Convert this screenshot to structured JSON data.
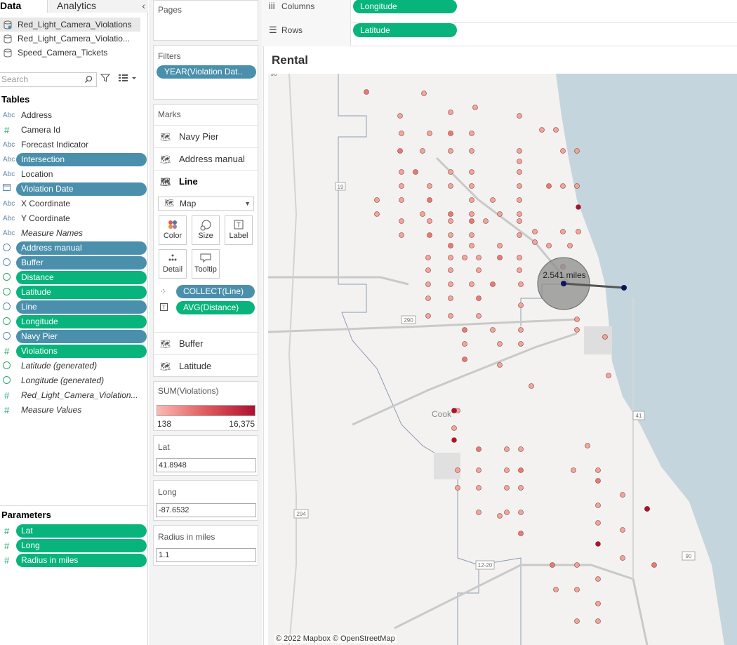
{
  "data_pane": {
    "tabs": {
      "data": "Data",
      "analytics": "Analytics"
    },
    "datasources": [
      "Red_Light_Camera_Violations",
      "Red_Light_Camera_Violatio...",
      "Speed_Camera_Tickets"
    ],
    "search_placeholder": "Search",
    "tables_title": "Tables",
    "fields": [
      {
        "type": "Abc",
        "name": "Address",
        "style": "plain"
      },
      {
        "type": "#",
        "name": "Camera Id",
        "style": "plain"
      },
      {
        "type": "Abc",
        "name": "Forecast Indicator",
        "style": "plain"
      },
      {
        "type": "Abc",
        "name": "Intersection",
        "style": "blue"
      },
      {
        "type": "Abc",
        "name": "Location",
        "style": "plain"
      },
      {
        "type": "date",
        "name": "Violation Date",
        "style": "blue"
      },
      {
        "type": "Abc",
        "name": "X Coordinate",
        "style": "plain"
      },
      {
        "type": "Abc",
        "name": "Y Coordinate",
        "style": "plain"
      },
      {
        "type": "Abc",
        "name": "Measure Names",
        "style": "italic"
      },
      {
        "type": "geo",
        "name": "Address manual",
        "style": "blue"
      },
      {
        "type": "geo",
        "name": "Buffer",
        "style": "blue"
      },
      {
        "type": "geo",
        "name": "Distance",
        "style": "green"
      },
      {
        "type": "geo",
        "name": "Latitude",
        "style": "green"
      },
      {
        "type": "geo",
        "name": "Line",
        "style": "blue"
      },
      {
        "type": "geo",
        "name": "Longitude",
        "style": "green"
      },
      {
        "type": "geo",
        "name": "Navy Pier",
        "style": "blue"
      },
      {
        "type": "#",
        "name": "Violations",
        "style": "green"
      },
      {
        "type": "geo",
        "name": "Latitude (generated)",
        "style": "italic"
      },
      {
        "type": "geo",
        "name": "Longitude (generated)",
        "style": "italic"
      },
      {
        "type": "#",
        "name": "Red_Light_Camera_Violation...",
        "style": "italic"
      },
      {
        "type": "#",
        "name": "Measure Values",
        "style": "italic"
      }
    ],
    "parameters_title": "Parameters",
    "parameters": [
      "Lat",
      "Long",
      "Radius in miles"
    ]
  },
  "shelves": {
    "pages_title": "Pages",
    "filters_title": "Filters",
    "filter_pill": "YEAR(Violation Dat..",
    "marks_title": "Marks",
    "marks_layers": [
      "Navy Pier",
      "Address manual",
      "Line"
    ],
    "mark_type": "Map",
    "mark_buttons": [
      "Color",
      "Size",
      "Label",
      "Detail",
      "Tooltip"
    ],
    "encodings": [
      {
        "icon": "detail",
        "label": "COLLECT(Line)",
        "color": "blue"
      },
      {
        "icon": "label",
        "label": "AVG(Distance)",
        "color": "green"
      }
    ],
    "marks_layers_bottom": [
      "Buffer",
      "Latitude"
    ],
    "legend": {
      "title": "SUM(Violations)",
      "min": "138",
      "max": "16,375"
    },
    "param_cards": [
      {
        "title": "Lat",
        "value": "41.8948"
      },
      {
        "title": "Long",
        "value": "-87.6532"
      },
      {
        "title": "Radius in miles",
        "value": "1.1"
      }
    ]
  },
  "columns_shelf": {
    "label": "Columns",
    "pill": "Longitude"
  },
  "rows_shelf": {
    "label": "Rows",
    "pill": "Latitude"
  },
  "viz": {
    "title": "Rental",
    "distance_label": "2.541 miles",
    "attribution": "© 2022 Mapbox © OpenStreetMap",
    "map_labels": {
      "cook": "Cook"
    },
    "highway_shields": [
      "90",
      "19",
      "290",
      "41",
      "294",
      "12-20",
      "41",
      "90"
    ],
    "colors": {
      "marker_light": "#f4a59b",
      "marker_dark": "#b5102a",
      "buffer": "#8c8c8c",
      "water": "#c5d5dd"
    }
  }
}
